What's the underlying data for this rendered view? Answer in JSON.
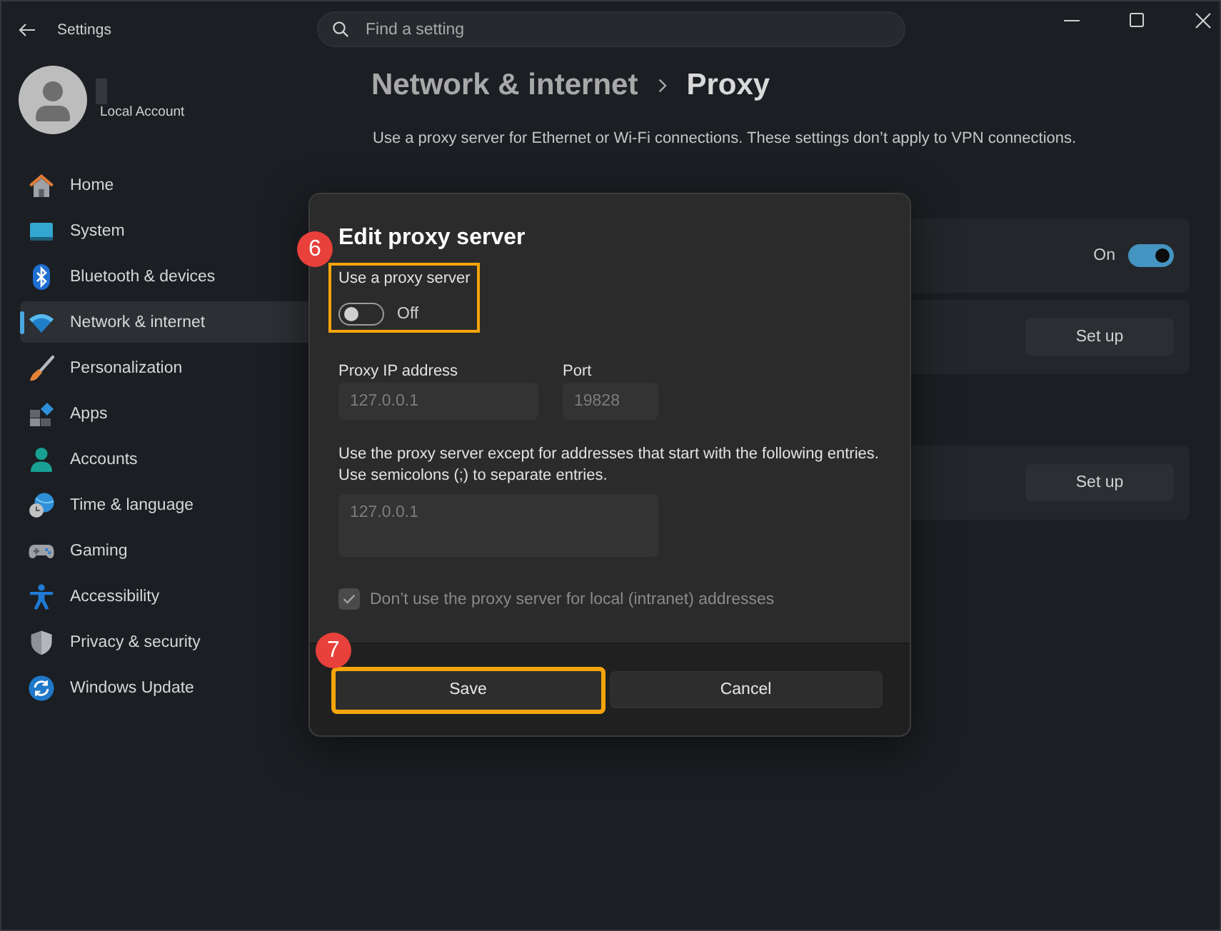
{
  "title_bar": {
    "title": "Settings",
    "search": {
      "placeholder": "Find a setting"
    }
  },
  "account": {
    "subtitle": "Local Account"
  },
  "sidebar": {
    "items": [
      {
        "label": "Home",
        "selected": false
      },
      {
        "label": "System",
        "selected": false
      },
      {
        "label": "Bluetooth & devices",
        "selected": false
      },
      {
        "label": "Network & internet",
        "selected": true
      },
      {
        "label": "Personalization",
        "selected": false
      },
      {
        "label": "Apps",
        "selected": false
      },
      {
        "label": "Accounts",
        "selected": false
      },
      {
        "label": "Time & language",
        "selected": false
      },
      {
        "label": "Gaming",
        "selected": false
      },
      {
        "label": "Accessibility",
        "selected": false
      },
      {
        "label": "Privacy & security",
        "selected": false
      },
      {
        "label": "Windows Update",
        "selected": false
      }
    ]
  },
  "page": {
    "breadcrumb": [
      {
        "label": "Network & internet",
        "current": false
      },
      {
        "label": "Proxy",
        "current": true
      }
    ],
    "description": "Use a proxy server for Ethernet or Wi-Fi connections. These settings don’t apply to VPN connections.",
    "sections": [
      {
        "cards": [
          {
            "kind": "toggle",
            "on": true,
            "state_label": "On"
          },
          {
            "kind": "button",
            "button": "Set up"
          }
        ]
      },
      {
        "cards": [
          {
            "kind": "button",
            "button": "Set up"
          }
        ]
      }
    ]
  },
  "dialog": {
    "title": "Edit proxy server",
    "use_proxy": {
      "label": "Use a proxy server",
      "on": false,
      "state_label": "Off",
      "highlighted": true,
      "step": "6"
    },
    "fields": [
      {
        "label": "Proxy IP address",
        "value": "127.0.0.1",
        "disabled": true
      },
      {
        "label": "Port",
        "value": "19828",
        "disabled": true
      }
    ],
    "exceptions": {
      "text": "Use the proxy server except for addresses that start with the following entries. Use semicolons (;) to separate entries.",
      "value": "127.0.0.1",
      "disabled": true
    },
    "local_bypass": {
      "label": "Don’t use the proxy server for local (intranet) addresses",
      "checked": true,
      "disabled": true
    },
    "buttons": [
      {
        "label": "Save",
        "highlighted": true,
        "step": "7"
      },
      {
        "label": "Cancel",
        "highlighted": false
      }
    ]
  }
}
